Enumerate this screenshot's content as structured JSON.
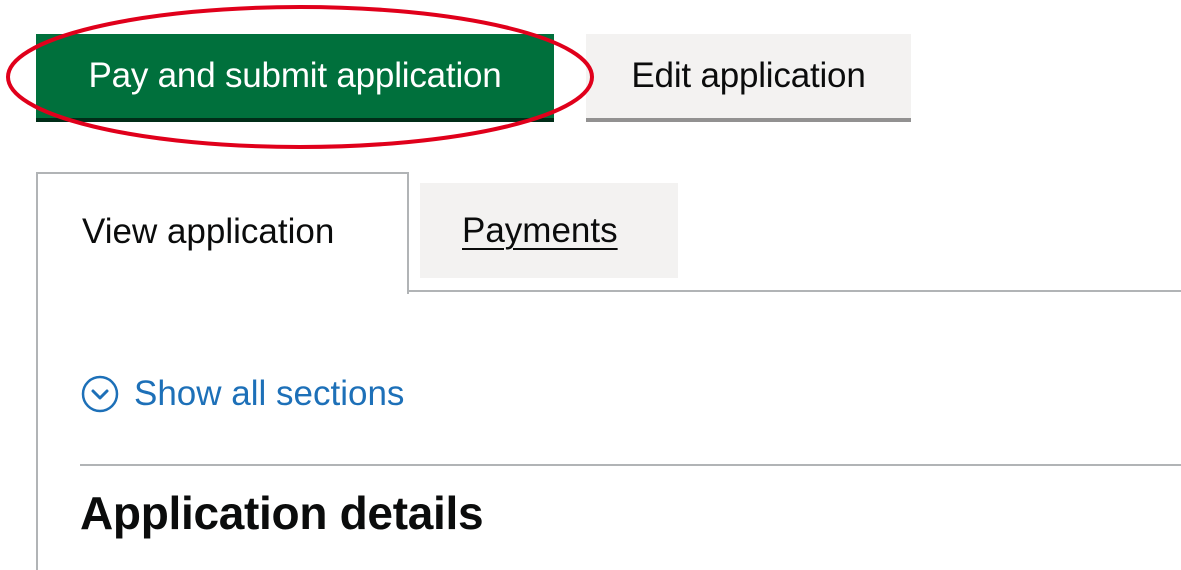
{
  "actions": {
    "primary_label": "Pay and submit application",
    "secondary_label": "Edit application"
  },
  "tabs": [
    {
      "label": "View application",
      "selected": true
    },
    {
      "label": "Payments",
      "selected": false
    }
  ],
  "accordion": {
    "show_all_label": "Show all sections",
    "icon": "chevron-down-circle-icon"
  },
  "section": {
    "heading": "Application details"
  },
  "colors": {
    "primary_button": "#00703c",
    "secondary_button": "#f3f2f1",
    "link": "#1d70b8",
    "highlight": "#e0001b",
    "border": "#b1b4b6"
  }
}
